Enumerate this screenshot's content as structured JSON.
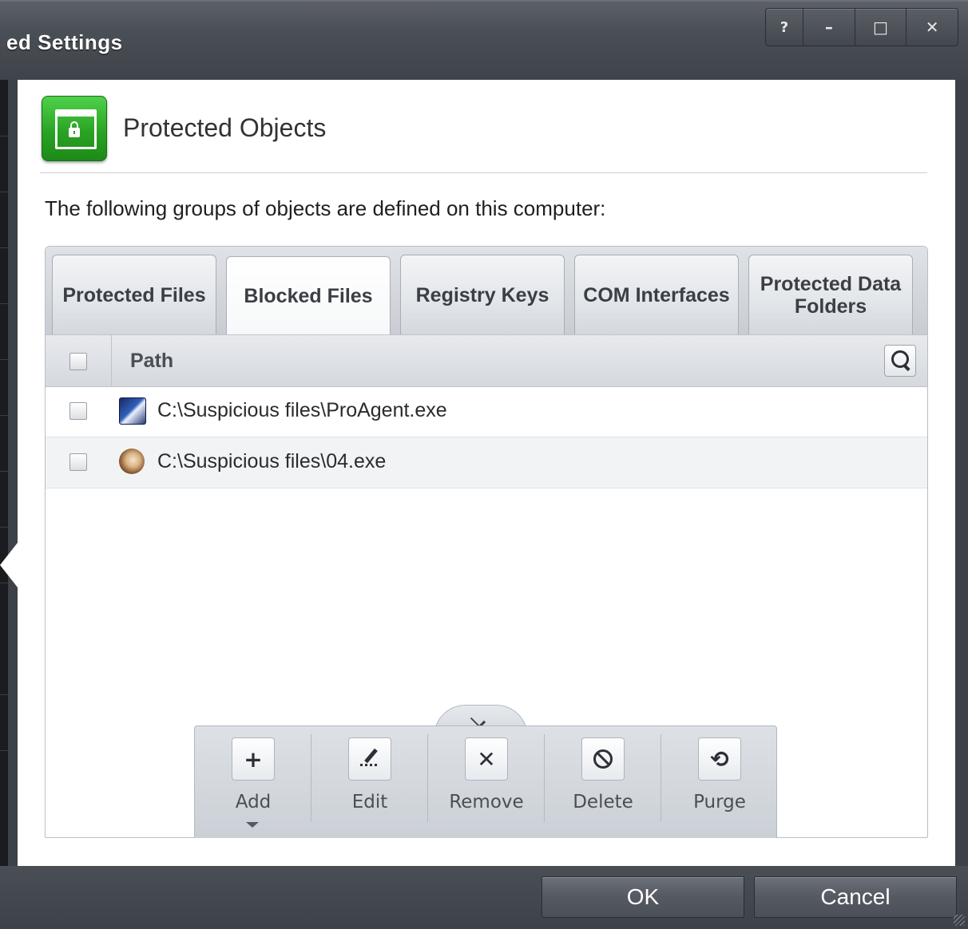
{
  "window": {
    "title": "ed Settings",
    "controls": {
      "help": "?",
      "minimize": "–",
      "maximize": "□",
      "close": "✕"
    }
  },
  "header": {
    "icon": "protected-objects-icon",
    "title": "Protected Objects"
  },
  "subtitle": "The following groups of objects are defined on this computer:",
  "tabs": [
    {
      "label": "Protected Files",
      "active": false
    },
    {
      "label": "Blocked Files",
      "active": true
    },
    {
      "label": "Registry Keys",
      "active": false
    },
    {
      "label": "COM Interfaces",
      "active": false
    },
    {
      "label": "Protected Data Folders",
      "active": false
    }
  ],
  "table": {
    "column": "Path",
    "rows": [
      {
        "path": "C:\\Suspicious files\\ProAgent.exe",
        "icon": "proagent-exe-icon",
        "checked": false
      },
      {
        "path": "C:\\Suspicious files\\04.exe",
        "icon": "exe04-icon",
        "checked": false
      }
    ]
  },
  "actions": {
    "add": "Add",
    "edit": "Edit",
    "remove": "Remove",
    "delete": "Delete",
    "purge": "Purge"
  },
  "footer": {
    "ok": "OK",
    "cancel": "Cancel"
  },
  "colors": {
    "accent_green": "#2aa324",
    "frame_dark": "#3d4249"
  }
}
